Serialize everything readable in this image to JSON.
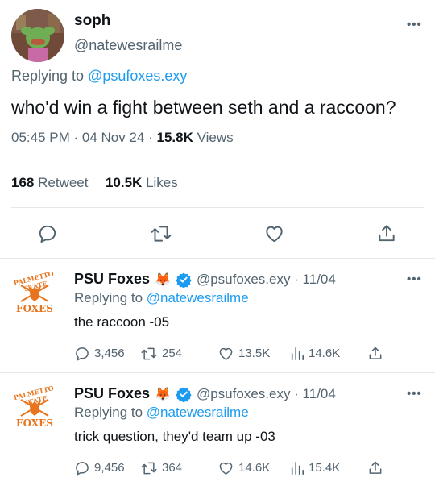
{
  "main_tweet": {
    "display_name": "soph",
    "handle": "@natewesrailme",
    "replying_prefix": "Replying to",
    "replying_to": "@psufoxes.exy",
    "text": "who'd win a fight between seth and a raccoon?",
    "time": "05:45 PM",
    "date": "04 Nov 24",
    "views_count": "15.8K",
    "views_label": "Views",
    "retweets_count": "168",
    "retweets_label": "Retweet",
    "likes_count": "10.5K",
    "likes_label": "Likes",
    "more_label": "•••"
  },
  "replies": [
    {
      "display_name": "PSU Foxes",
      "emoji": "🦊",
      "handle_date": "@psufoxes.exy · 11/04",
      "replying_prefix": "Replying to",
      "replying_to": "@natewesrailme",
      "text": "the raccoon -05",
      "replies": "3,456",
      "retweets": "254",
      "likes": "13.5K",
      "views": "14.6K",
      "logo_top": "PALMETTO STATE",
      "logo_bottom": "FOXES"
    },
    {
      "display_name": "PSU Foxes",
      "emoji": "🦊",
      "handle_date": "@psufoxes.exy · 11/04",
      "replying_prefix": "Replying to",
      "replying_to": "@natewesrailme",
      "text": "trick question, they'd team up -03",
      "replies": "9,456",
      "retweets": "364",
      "likes": "14.6K",
      "views": "15.4K",
      "logo_top": "PALMETTO STATE",
      "logo_bottom": "FOXES"
    }
  ],
  "colors": {
    "link": "#1d9bf0",
    "muted": "#536471",
    "verified": "#1d9bf0",
    "logo_orange": "#e8741d"
  },
  "icons": [
    "reply-icon",
    "retweet-icon",
    "like-icon",
    "share-icon",
    "views-icon",
    "verified-icon",
    "more-icon"
  ]
}
